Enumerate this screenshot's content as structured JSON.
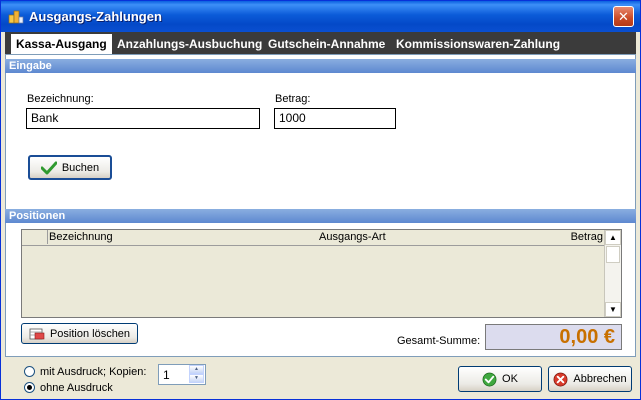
{
  "window": {
    "title": "Ausgangs-Zahlungen",
    "close_label": "✕"
  },
  "tabs": [
    {
      "label": "Kassa-Ausgang",
      "active": true
    },
    {
      "label": "Anzahlungs-Ausbuchung",
      "active": false
    },
    {
      "label": "Gutschein-Annahme",
      "active": false
    },
    {
      "label": "Kommissionswaren-Zahlung",
      "active": false
    }
  ],
  "eingabe": {
    "header": "Eingabe",
    "bezeichnung_label": "Bezeichnung:",
    "bezeichnung_value": "Bank",
    "betrag_label": "Betrag:",
    "betrag_value": "1000",
    "buchen_label": "Buchen"
  },
  "positionen": {
    "header": "Positionen",
    "columns": [
      "Bezeichnung",
      "Ausgangs-Art",
      "Betrag"
    ],
    "rows": [],
    "delete_label": "Position löschen",
    "total_label": "Gesamt-Summe:",
    "total_value": "0,00 €"
  },
  "print_options": {
    "with_print_label": "mit Ausdruck; Kopien:",
    "without_print_label": "ohne Ausdruck",
    "selected": "ohne Ausdruck",
    "copies": "1"
  },
  "footer": {
    "ok_label": "OK",
    "cancel_label": "Abbrechen"
  },
  "colors": {
    "titlebar": "#0b5bd8",
    "total_text": "#c87000",
    "total_bg": "#dcdcee",
    "section_header": "#6f96d8"
  }
}
